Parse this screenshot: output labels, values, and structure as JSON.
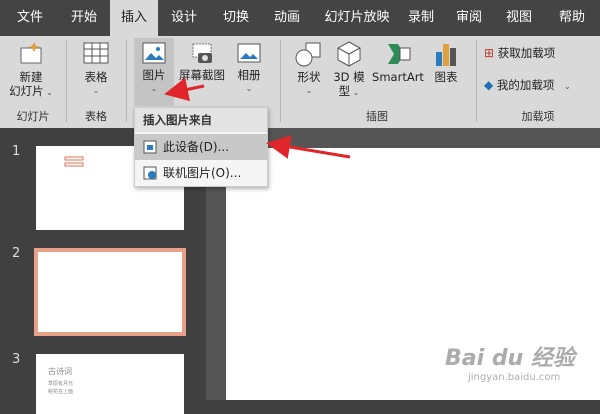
{
  "tabs": [
    "文件",
    "开始",
    "插入",
    "设计",
    "切换",
    "动画",
    "幻灯片放映",
    "录制",
    "审阅",
    "视图",
    "帮助"
  ],
  "ribbon": {
    "new_slide": [
      "新建",
      "幻灯片"
    ],
    "table": "表格",
    "picture": "图片",
    "screenshot": "屏幕截图",
    "album": "相册",
    "shapes": "形状",
    "model3d": [
      "3D 模",
      "型"
    ],
    "smartart": "SmartArt",
    "chart": "图表",
    "get_addins": "获取加载项",
    "my_addins": "我的加载项",
    "groups": {
      "slides": "幻灯片",
      "tables": "表格",
      "illustrations": "插图",
      "addins": "加载项"
    }
  },
  "dropdown": {
    "header": "插入图片来自",
    "this_device": "此设备(D)...",
    "online": "联机图片(O)..."
  },
  "thumbnails": [
    {
      "num": "1"
    },
    {
      "num": "2"
    },
    {
      "num": "3",
      "title": "古诗词",
      "bullets": [
        "草原有月光",
        "稻花在上面"
      ]
    }
  ],
  "watermark": {
    "main": "Bai du 经验",
    "sub": "jingyan.baidu.com"
  },
  "colors": {
    "accent": "#e8a088",
    "arrow": "#e0262b"
  }
}
